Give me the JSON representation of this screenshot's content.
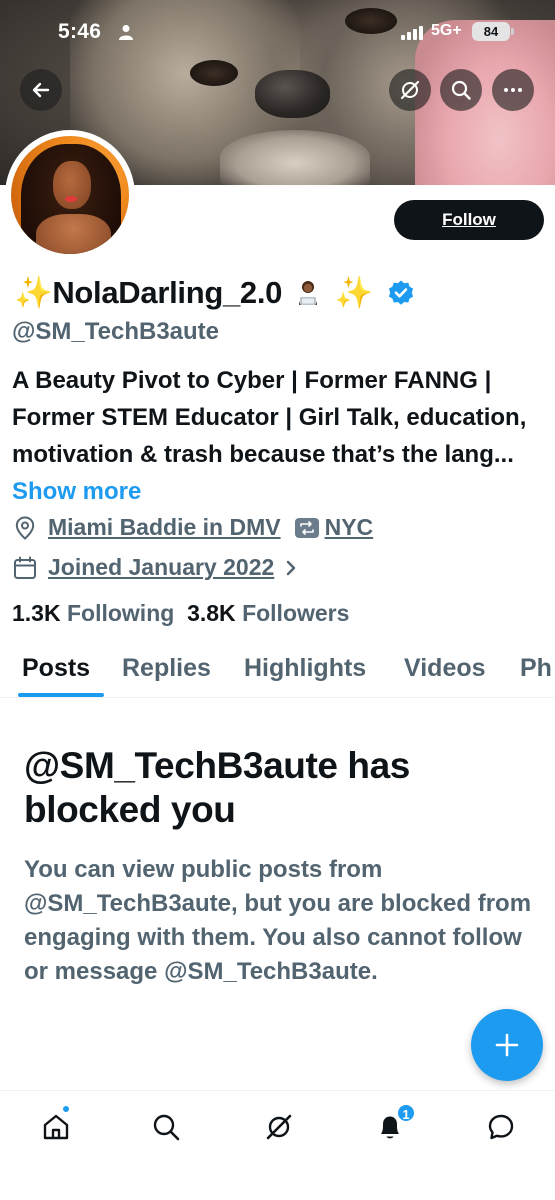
{
  "status_bar": {
    "time": "5:46",
    "network": "5G+",
    "battery": "84"
  },
  "profile": {
    "display_name": "NolaDarling_2.0",
    "name_prefix_emoji": "✨",
    "name_suffix_emoji": "✨",
    "laptop_emoji_icon": "woman-technologist-icon",
    "verified": true,
    "handle": "@SM_TechB3aute",
    "bio": "A Beauty Pivot to Cyber | Former FANNG | Former STEM Educator | Girl Talk, education, motivation & trash because that’s the lang...",
    "show_more": "Show more",
    "location_part1": "Miami Baddie in DMV",
    "location_part2": "NYC",
    "joined": "Joined January 2022",
    "following_count": "1.3K",
    "following_label": "Following",
    "followers_count": "3.8K",
    "followers_label": "Followers"
  },
  "actions": {
    "follow_label": "Follow"
  },
  "tabs": [
    {
      "label": "Posts",
      "active": true
    },
    {
      "label": "Replies",
      "active": false
    },
    {
      "label": "Highlights",
      "active": false
    },
    {
      "label": "Videos",
      "active": false
    },
    {
      "label": "Ph",
      "active": false
    }
  ],
  "blocked": {
    "title": "@SM_TechB3aute has blocked you",
    "body": "You can view public posts from @SM_TechB3aute, but you are blocked from engaging with them. You also cannot follow or message @SM_TechB3aute."
  },
  "bottom_nav": {
    "notifications_badge": "1"
  },
  "colors": {
    "accent": "#1d9bf0",
    "text_primary": "#0f1419",
    "text_secondary": "#536471"
  }
}
